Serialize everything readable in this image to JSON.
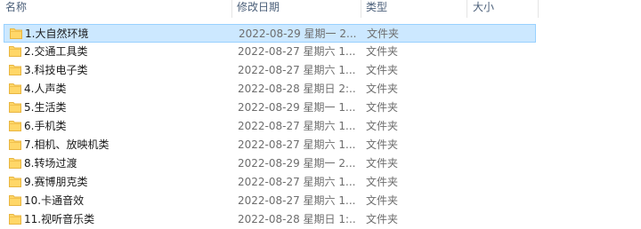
{
  "columns": {
    "name": "名称",
    "modified": "修改日期",
    "type": "类型",
    "size": "大小"
  },
  "rows": [
    {
      "name": "1.大自然环境",
      "modified": "2022-08-29 星期一 2...",
      "type": "文件夹",
      "size": "",
      "selected": true
    },
    {
      "name": "2.交通工具类",
      "modified": "2022-08-27 星期六 1...",
      "type": "文件夹",
      "size": ""
    },
    {
      "name": "3.科技电子类",
      "modified": "2022-08-27 星期六 1...",
      "type": "文件夹",
      "size": ""
    },
    {
      "name": "4.人声类",
      "modified": "2022-08-28 星期日 2:...",
      "type": "文件夹",
      "size": ""
    },
    {
      "name": "5.生活类",
      "modified": "2022-08-29 星期一 1...",
      "type": "文件夹",
      "size": ""
    },
    {
      "name": "6.手机类",
      "modified": "2022-08-27 星期六 1...",
      "type": "文件夹",
      "size": ""
    },
    {
      "name": "7.相机、放映机类",
      "modified": "2022-08-27 星期六 1...",
      "type": "文件夹",
      "size": ""
    },
    {
      "name": "8.转场过渡",
      "modified": "2022-08-29 星期一 2...",
      "type": "文件夹",
      "size": ""
    },
    {
      "name": "9.赛博朋克类",
      "modified": "2022-08-27 星期六 1...",
      "type": "文件夹",
      "size": ""
    },
    {
      "name": "10.卡通音效",
      "modified": "2022-08-27 星期六 1...",
      "type": "文件夹",
      "size": ""
    },
    {
      "name": "11.视听音乐类",
      "modified": "2022-08-28 星期日 1:...",
      "type": "文件夹",
      "size": ""
    }
  ],
  "icon": "folder-icon",
  "colors": {
    "folder": "#ffd768",
    "folder_dark": "#e8b540",
    "selected_bg": "#cce8ff",
    "selected_border": "#99d1ff",
    "header_text": "#4c607a"
  }
}
